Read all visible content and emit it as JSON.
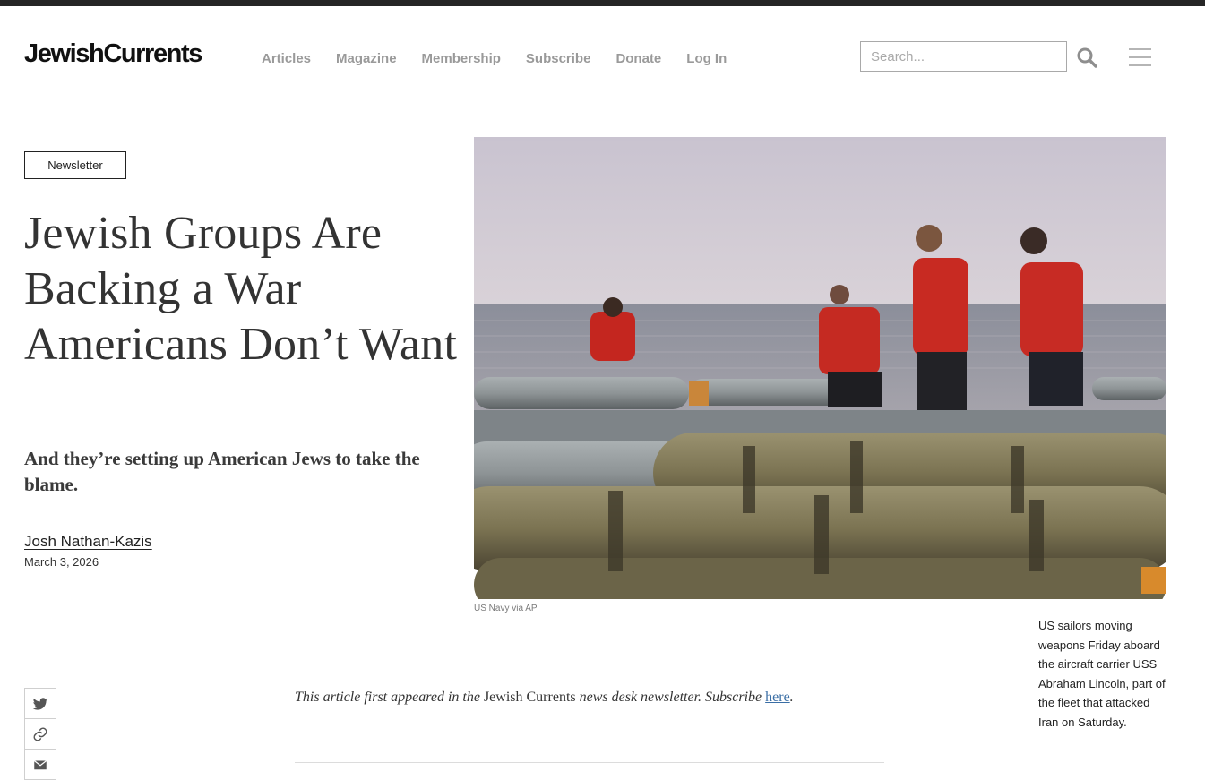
{
  "header": {
    "logo": "JewishCurrents",
    "nav": [
      "Articles",
      "Magazine",
      "Membership",
      "Subscribe",
      "Donate",
      "Log In"
    ],
    "search_placeholder": "Search..."
  },
  "article": {
    "tag": "Newsletter",
    "headline": "Jewish Groups Are Backing a War Americans Don’t Want",
    "dek": "And they’re setting up American Jews to take the blame.",
    "author": "Josh Nathan-Kazis",
    "date": "March 3, 2026",
    "image_credit": "US Navy via AP",
    "caption": "US sailors moving weapons Friday aboard the aircraft carrier USS Abraham Lincoln, part of the fleet that attacked Iran on Saturday.",
    "intro": {
      "pre": "This article first appeared in the ",
      "pub": "Jewish Currents",
      "mid": " news desk newsletter. Subscribe ",
      "link": "here",
      "post": "."
    }
  },
  "share": {
    "icons": [
      "twitter-icon",
      "link-icon",
      "email-icon"
    ]
  },
  "colors": {
    "nav_text": "#9a9a9a",
    "headline": "#333333",
    "link": "#3a6ea5",
    "top_bar": "#262626"
  }
}
